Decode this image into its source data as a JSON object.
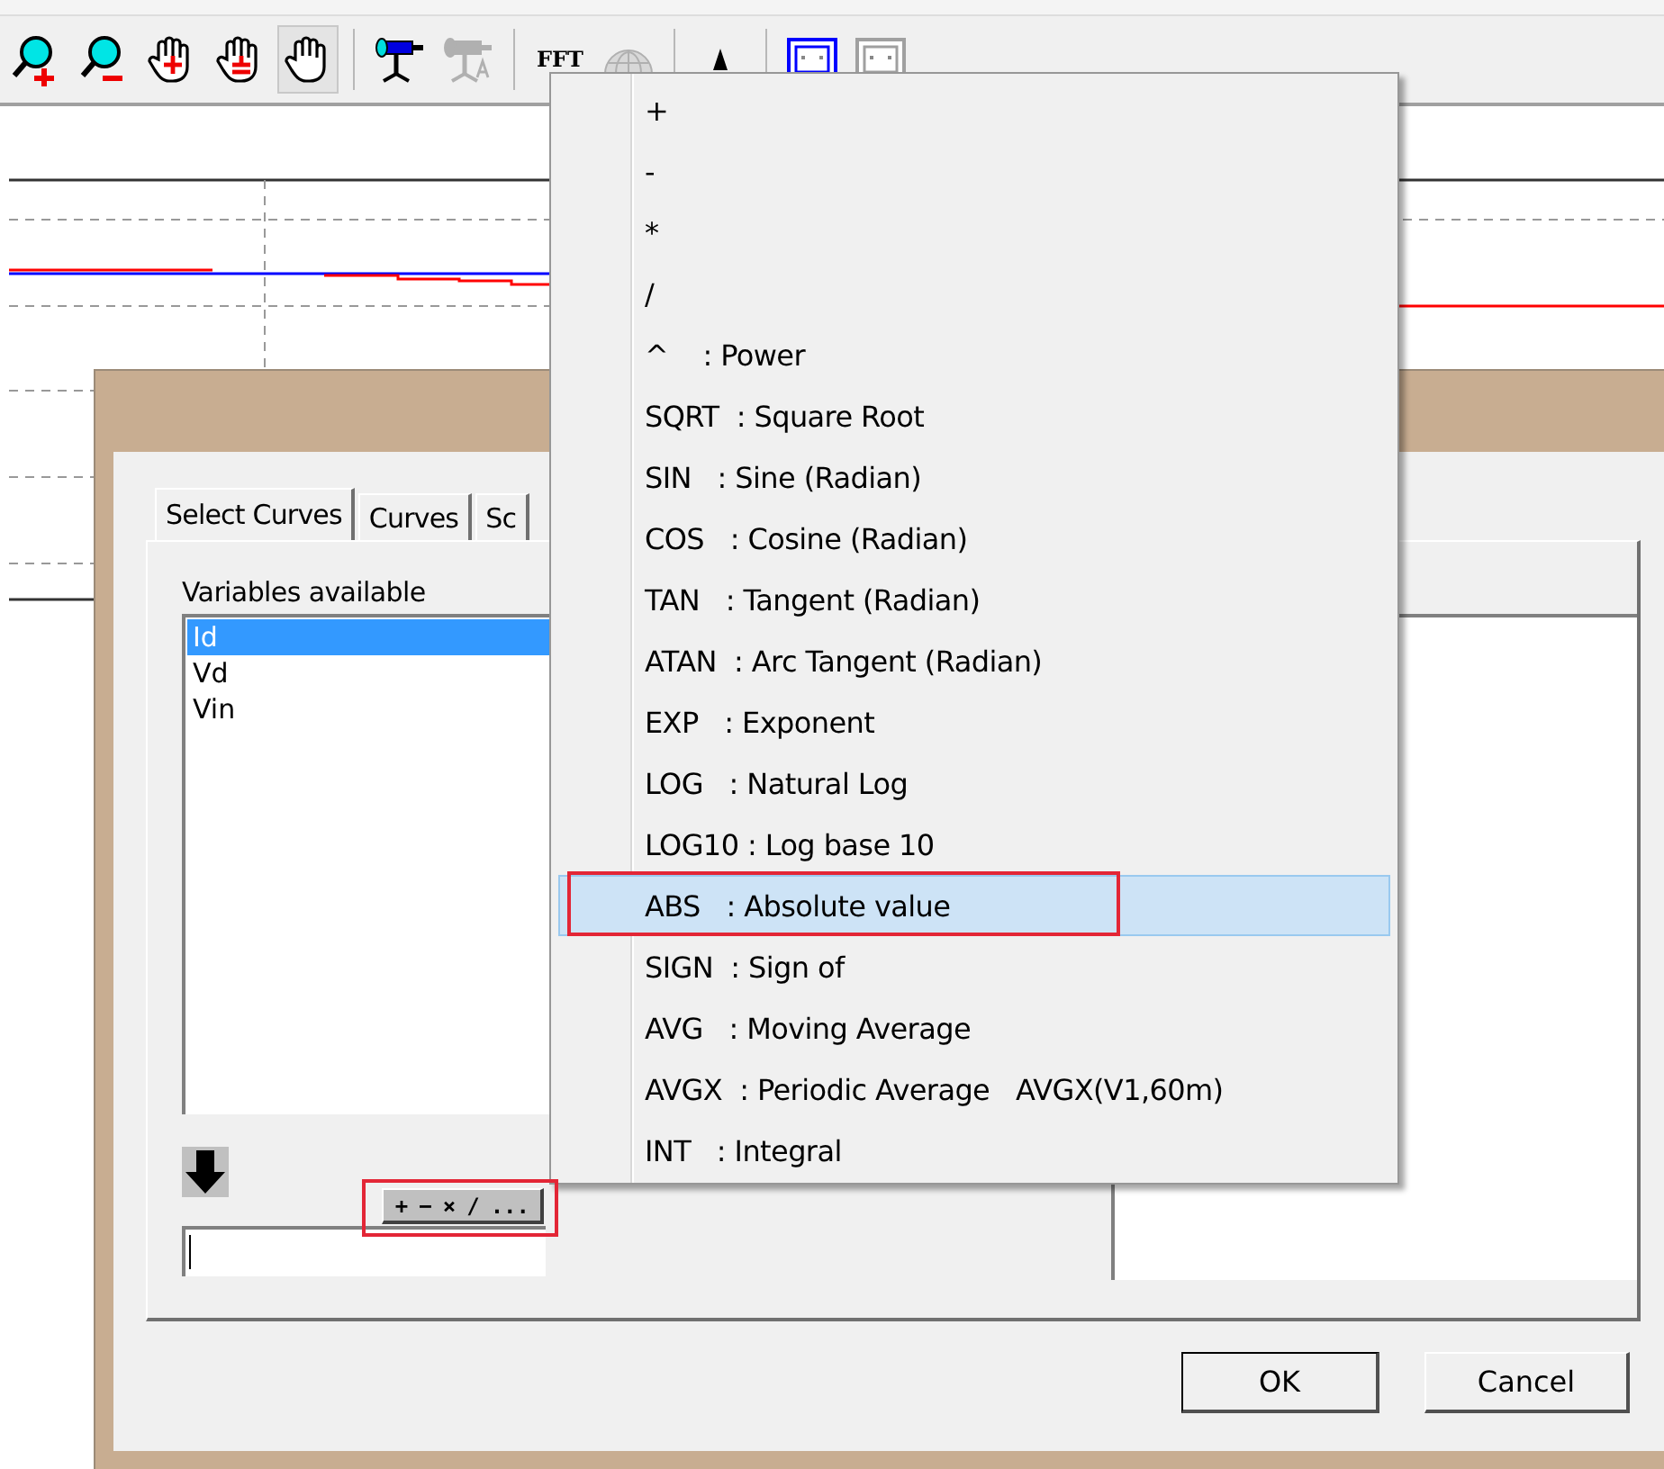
{
  "toolbar": [
    {
      "kind": "zoom-in",
      "pressed": false,
      "disabled": false
    },
    {
      "kind": "zoom-out",
      "pressed": false,
      "disabled": false
    },
    {
      "kind": "hand-move",
      "pressed": false,
      "disabled": false
    },
    {
      "kind": "hand-plus",
      "pressed": false,
      "disabled": false
    },
    {
      "kind": "hand",
      "pressed": true,
      "disabled": false
    },
    {
      "kind": "separator"
    },
    {
      "kind": "telescope",
      "pressed": false,
      "disabled": false
    },
    {
      "kind": "telescope-text",
      "pressed": false,
      "disabled": true
    },
    {
      "kind": "separator"
    },
    {
      "kind": "fft",
      "label": "FFT",
      "pressed": false,
      "disabled": false
    },
    {
      "kind": "dome",
      "pressed": false,
      "disabled": true
    },
    {
      "kind": "separator"
    },
    {
      "kind": "pointer",
      "pressed": false,
      "disabled": false
    },
    {
      "kind": "separator"
    },
    {
      "kind": "window",
      "pressed": false,
      "disabled": false
    },
    {
      "kind": "window-x",
      "pressed": false,
      "disabled": true
    }
  ],
  "dialog": {
    "tabs": [
      {
        "label": "Select Curves",
        "selected": true
      },
      {
        "label": "Curves",
        "selected": false
      },
      {
        "label": "Sc",
        "selected": false
      }
    ],
    "variables_label": "Variables available",
    "variables": [
      {
        "name": "Id",
        "selected": true
      },
      {
        "name": "Vd",
        "selected": false
      },
      {
        "name": "Vin",
        "selected": false
      }
    ],
    "operators": [
      "+",
      "−",
      "×",
      "∕",
      "..."
    ],
    "buttons": [
      {
        "label": "OK",
        "default": true
      },
      {
        "label": "Cancel",
        "default": false
      }
    ]
  },
  "menu": [
    {
      "label": "+",
      "selected": false
    },
    {
      "label": "-",
      "selected": false
    },
    {
      "label": "*",
      "selected": false
    },
    {
      "label": "/",
      "selected": false
    },
    {
      "label": "^    : Power",
      "selected": false
    },
    {
      "label": "SQRT  : Square Root",
      "selected": false
    },
    {
      "label": "SIN   : Sine (Radian)",
      "selected": false
    },
    {
      "label": "COS   : Cosine (Radian)",
      "selected": false
    },
    {
      "label": "TAN   : Tangent (Radian)",
      "selected": false
    },
    {
      "label": "ATAN  : Arc Tangent (Radian)",
      "selected": false
    },
    {
      "label": "EXP   : Exponent",
      "selected": false
    },
    {
      "label": "LOG   : Natural Log",
      "selected": false
    },
    {
      "label": "LOG10 : Log base 10",
      "selected": false
    },
    {
      "label": "ABS   : Absolute value",
      "selected": true
    },
    {
      "label": "SIGN  : Sign of",
      "selected": false
    },
    {
      "label": "AVG   : Moving Average",
      "selected": false
    },
    {
      "label": "AVGX  : Periodic Average   AVGX(V1,60m)",
      "selected": false
    },
    {
      "label": "INT   : Integral",
      "selected": false
    }
  ]
}
